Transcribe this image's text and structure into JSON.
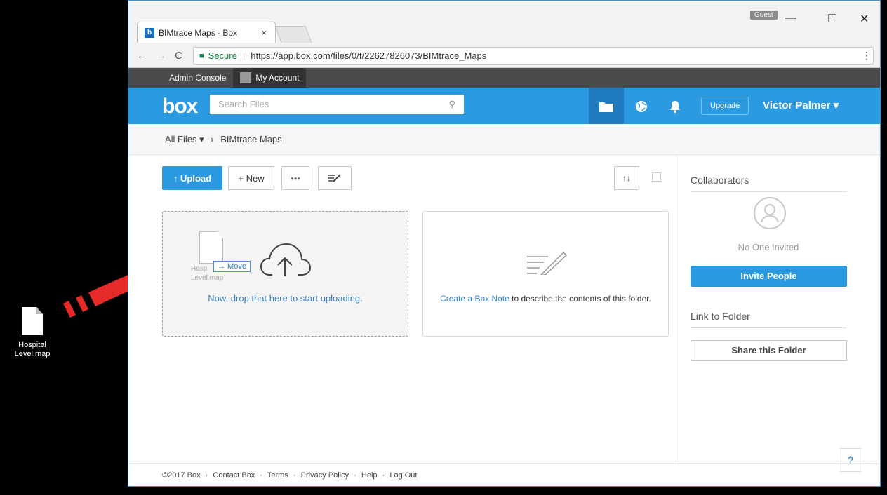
{
  "desktop": {
    "file_line1": "Hospital",
    "file_line2": "Level.map"
  },
  "browser": {
    "tab_title": "BIMtrace Maps - Box",
    "tab_close": "×",
    "favicon": "b",
    "guest": "Guest",
    "window_controls": {
      "minimize": "—",
      "maximize": "☐",
      "close": "✕"
    },
    "secure_label": "Secure",
    "url": "https://app.box.com/files/0/f/22627826073/BIMtrace_Maps",
    "bookmarks": [
      "Admin Console",
      "My Account"
    ]
  },
  "header": {
    "logo": "box",
    "search_placeholder": "Search Files",
    "upgrade_label": "Upgrade",
    "username": "Victor Palmer ▾"
  },
  "breadcrumb": {
    "root": "All Files ▾",
    "separator": "›",
    "current": "BIMtrace Maps"
  },
  "toolbar": {
    "upload_label": "↑ Upload",
    "new_label": "+ New",
    "more_label": "•••"
  },
  "dropzone": {
    "ghost_line1": "Hosp",
    "ghost_line2": "Level.map",
    "move_label": "→ Move",
    "text": "Now, drop that here to start uploading."
  },
  "note_card": {
    "link": "Create a Box Note",
    "text": " to describe the contents of this folder."
  },
  "sidebar": {
    "collaborators": "Collaborators",
    "no_one": "No One Invited",
    "invite": "Invite People",
    "link_heading": "Link to Folder",
    "share": "Share this Folder"
  },
  "help": "?",
  "footer": [
    "©2017 Box",
    "·",
    "Contact Box",
    "·",
    "Terms",
    "·",
    "Privacy Policy",
    "·",
    "Help",
    "·",
    "Log Out"
  ],
  "colors": {
    "brand": "#2c9ae0",
    "arrow": "#e52a2a"
  }
}
